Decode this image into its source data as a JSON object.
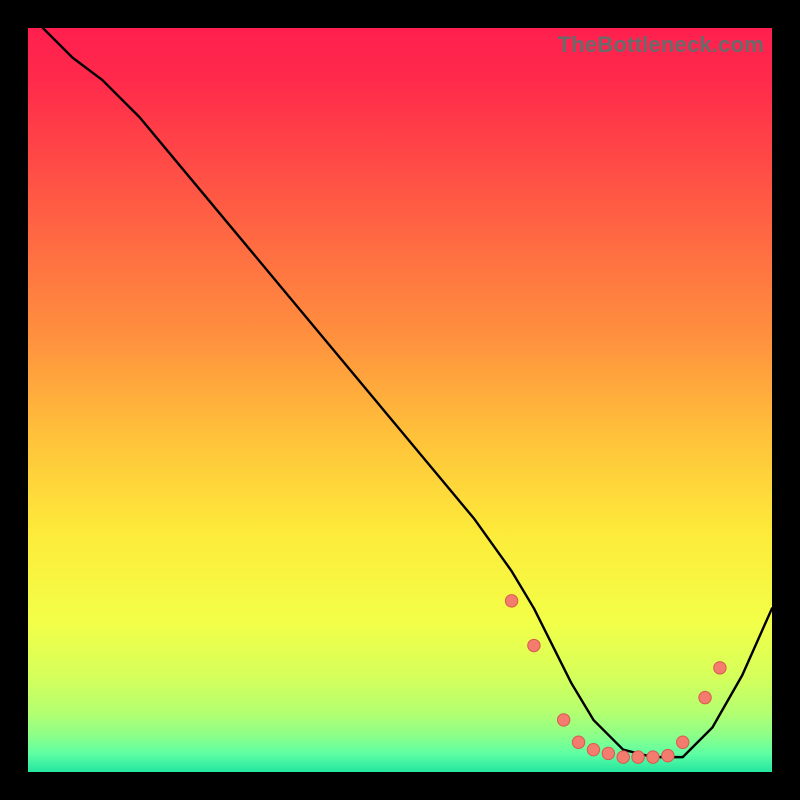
{
  "watermark": "TheBottleneck.com",
  "chart_data": {
    "type": "line",
    "title": "",
    "xlabel": "",
    "ylabel": "",
    "xlim": [
      0,
      100
    ],
    "ylim": [
      0,
      100
    ],
    "grid": false,
    "series": [
      {
        "name": "curve",
        "x": [
          0,
          2,
          6,
          10,
          15,
          20,
          25,
          30,
          35,
          40,
          45,
          50,
          55,
          60,
          65,
          68,
          70,
          73,
          76,
          80,
          84,
          88,
          92,
          96,
          100
        ],
        "y": [
          103,
          100,
          96,
          93,
          88,
          82,
          76,
          70,
          64,
          58,
          52,
          46,
          40,
          34,
          27,
          22,
          18,
          12,
          7,
          3,
          2,
          2,
          6,
          13,
          22
        ]
      }
    ],
    "markers": [
      {
        "x": 65,
        "y": 23
      },
      {
        "x": 68,
        "y": 17
      },
      {
        "x": 72,
        "y": 7
      },
      {
        "x": 74,
        "y": 4
      },
      {
        "x": 76,
        "y": 3
      },
      {
        "x": 78,
        "y": 2.5
      },
      {
        "x": 80,
        "y": 2
      },
      {
        "x": 82,
        "y": 2
      },
      {
        "x": 84,
        "y": 2
      },
      {
        "x": 86,
        "y": 2.2
      },
      {
        "x": 88,
        "y": 4
      },
      {
        "x": 91,
        "y": 10
      },
      {
        "x": 93,
        "y": 14
      }
    ],
    "gradient_stops": [
      {
        "offset": 0.0,
        "color": "#ff1f4f"
      },
      {
        "offset": 0.07,
        "color": "#ff2a4b"
      },
      {
        "offset": 0.18,
        "color": "#ff4a46"
      },
      {
        "offset": 0.3,
        "color": "#ff6e42"
      },
      {
        "offset": 0.42,
        "color": "#ff923e"
      },
      {
        "offset": 0.55,
        "color": "#ffc23a"
      },
      {
        "offset": 0.68,
        "color": "#fdeb3a"
      },
      {
        "offset": 0.8,
        "color": "#f2ff48"
      },
      {
        "offset": 0.87,
        "color": "#d6ff5a"
      },
      {
        "offset": 0.92,
        "color": "#b4ff70"
      },
      {
        "offset": 0.95,
        "color": "#8dff88"
      },
      {
        "offset": 0.975,
        "color": "#5fffa3"
      },
      {
        "offset": 1.0,
        "color": "#24e6a0"
      }
    ]
  }
}
